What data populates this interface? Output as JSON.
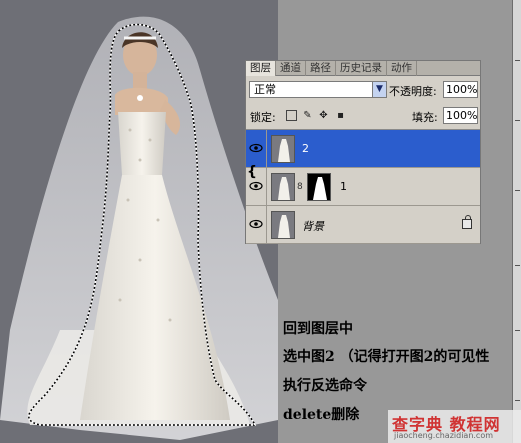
{
  "layers_panel": {
    "tabs": [
      {
        "label": "图层",
        "active": true
      },
      {
        "label": "通道",
        "active": false
      },
      {
        "label": "路径",
        "active": false
      },
      {
        "label": "历史记录",
        "active": false
      },
      {
        "label": "动作",
        "active": false
      }
    ],
    "blend_mode": "正常",
    "opacity_label": "不透明度:",
    "opacity_value": "100%",
    "lock_label": "锁定:",
    "fill_label": "填充:",
    "fill_value": "100%",
    "layers": [
      {
        "name": "2",
        "selected": true,
        "visible": true
      },
      {
        "name": "1",
        "selected": false,
        "visible": true,
        "has_mask": true
      },
      {
        "name": "背景",
        "selected": false,
        "visible": true,
        "locked": true
      }
    ]
  },
  "instructions": [
    "回到图层中",
    "选中图2 （记得打开图2的可见性",
    "执行反选命令",
    "delete删除"
  ],
  "watermark": {
    "title": "查字典 教程网",
    "url": "jiaocheng.chazidian.com"
  },
  "colors": {
    "selection_blue": "#2b5dcd",
    "canvas_gray": "#6e6f76",
    "watermark_red": "#d03333"
  }
}
